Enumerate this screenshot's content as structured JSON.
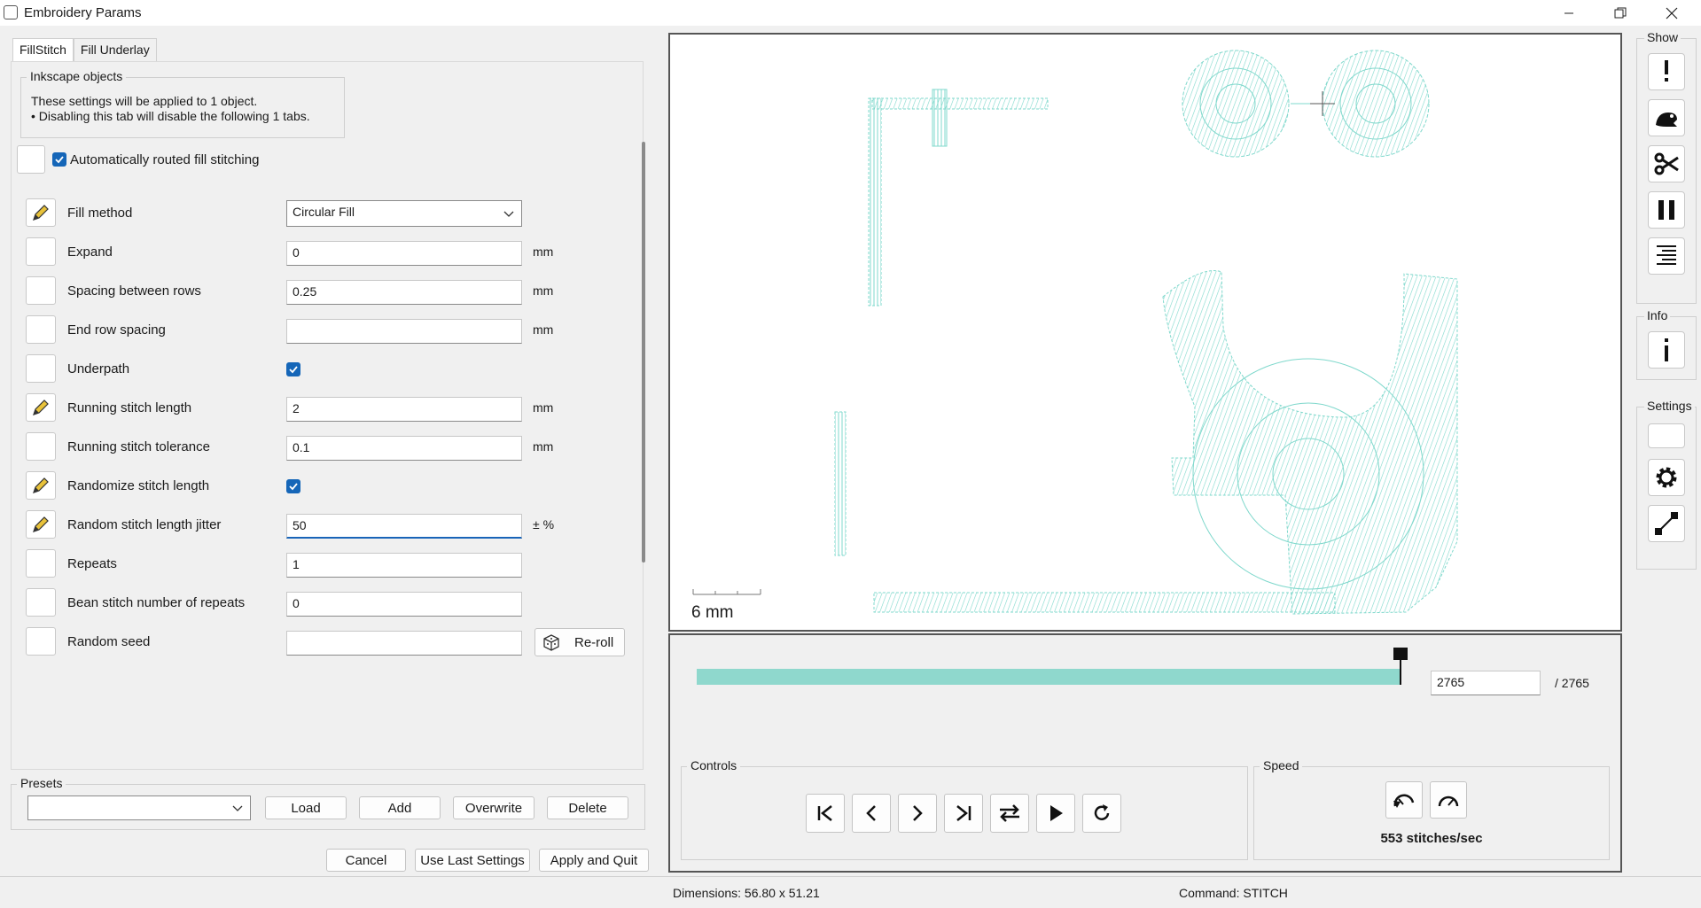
{
  "window": {
    "title": "Embroidery Params"
  },
  "tabs": [
    {
      "label": "FillStitch",
      "active": true
    },
    {
      "label": "Fill Underlay",
      "active": false
    }
  ],
  "inkscape_objects": {
    "legend": "Inkscape objects",
    "line1": "These settings will be applied to 1 object.",
    "line2": "• Disabling this tab will disable the following 1 tabs."
  },
  "auto_route": {
    "label": "Automatically routed fill stitching",
    "checked": true
  },
  "params": [
    {
      "label": "Fill method",
      "type": "select",
      "value": "Circular Fill",
      "edited": true
    },
    {
      "label": "Expand",
      "type": "text",
      "value": "0",
      "unit": "mm",
      "edited": false
    },
    {
      "label": "Spacing between rows",
      "type": "text",
      "value": "0.25",
      "unit": "mm",
      "edited": false
    },
    {
      "label": "End row spacing",
      "type": "text",
      "value": "",
      "unit": "mm",
      "edited": false
    },
    {
      "label": "Underpath",
      "type": "checkbox",
      "checked": true,
      "edited": false
    },
    {
      "label": "Running stitch length",
      "type": "text",
      "value": "2",
      "unit": "mm",
      "edited": true
    },
    {
      "label": "Running stitch tolerance",
      "type": "text",
      "value": "0.1",
      "unit": "mm",
      "edited": false
    },
    {
      "label": "Randomize stitch length",
      "type": "checkbox",
      "checked": true,
      "edited": true
    },
    {
      "label": "Random stitch length jitter",
      "type": "text",
      "value": "50",
      "unit": "± %",
      "edited": true,
      "focused": true
    },
    {
      "label": "Repeats",
      "type": "text",
      "value": "1",
      "unit": "",
      "edited": false
    },
    {
      "label": "Bean stitch number of repeats",
      "type": "text",
      "value": "0",
      "unit": "",
      "edited": false
    },
    {
      "label": "Random seed",
      "type": "text",
      "value": "",
      "unit": "",
      "edited": false
    }
  ],
  "reroll_label": "Re-roll",
  "presets": {
    "legend": "Presets",
    "selected": "",
    "load": "Load",
    "add": "Add",
    "overwrite": "Overwrite",
    "delete": "Delete"
  },
  "footer": {
    "cancel": "Cancel",
    "use_last": "Use Last Settings",
    "apply": "Apply and Quit"
  },
  "preview": {
    "scale_label": "6 mm",
    "stitch_color": "#7fd8cc",
    "current_stitch": "2765",
    "total_stitches": "/ 2765",
    "progress": 1.0
  },
  "controls": {
    "legend": "Controls"
  },
  "speed": {
    "legend": "Speed",
    "value": "553 stitches/sec"
  },
  "side": {
    "show_legend": "Show",
    "info_legend": "Info",
    "settings_legend": "Settings"
  },
  "status": {
    "dimensions": "Dimensions: 56.80 x 51.21",
    "command": "Command: STITCH"
  }
}
